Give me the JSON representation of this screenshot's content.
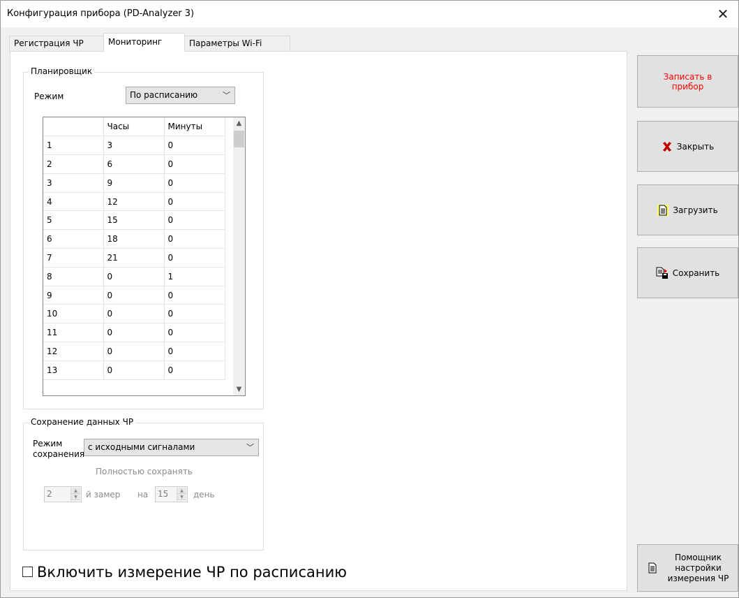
{
  "window": {
    "title": "Конфигурация прибора (PD-Analyzer 3)",
    "close_glyph": "✕"
  },
  "tabs": [
    {
      "label": "Регистрация ЧР",
      "active": false
    },
    {
      "label": "Мониторинг",
      "active": true
    },
    {
      "label": "Параметры Wi-Fi",
      "active": false
    }
  ],
  "scheduler": {
    "title": "Планировщик",
    "mode_label": "Режим",
    "mode_value": "По расписанию",
    "columns": [
      "",
      "Часы",
      "Минуты"
    ],
    "rows": [
      [
        "1",
        "3",
        "0"
      ],
      [
        "2",
        "6",
        "0"
      ],
      [
        "3",
        "9",
        "0"
      ],
      [
        "4",
        "12",
        "0"
      ],
      [
        "5",
        "15",
        "0"
      ],
      [
        "6",
        "18",
        "0"
      ],
      [
        "7",
        "21",
        "0"
      ],
      [
        "8",
        "0",
        "1"
      ],
      [
        "9",
        "0",
        "0"
      ],
      [
        "10",
        "0",
        "0"
      ],
      [
        "11",
        "0",
        "0"
      ],
      [
        "12",
        "0",
        "0"
      ],
      [
        "13",
        "0",
        "0"
      ]
    ]
  },
  "save_data": {
    "title": "Сохранение данных ЧР",
    "mode_label_line1": "Режим",
    "mode_label_line2": "сохранения",
    "mode_value": "с исходными сигналами",
    "fully_save_label": "Полностью сохранять",
    "measure_value": "2",
    "measure_suffix": "й замер",
    "on_label": "на",
    "day_value": "15",
    "day_suffix": "день"
  },
  "schedule_checkbox": {
    "label": "Включить измерение ЧР по расписанию",
    "checked": false
  },
  "buttons": {
    "write_line1": "Записать в",
    "write_line2": "прибор",
    "close": "Закрыть",
    "load": "Загрузить",
    "save": "Сохранить",
    "assistant_line1": "Помощник",
    "assistant_line2": "настройки",
    "assistant_line3": "измерения ЧР"
  },
  "colors": {
    "write_button_text": "#ff0000",
    "close_icon": "#c00000"
  }
}
